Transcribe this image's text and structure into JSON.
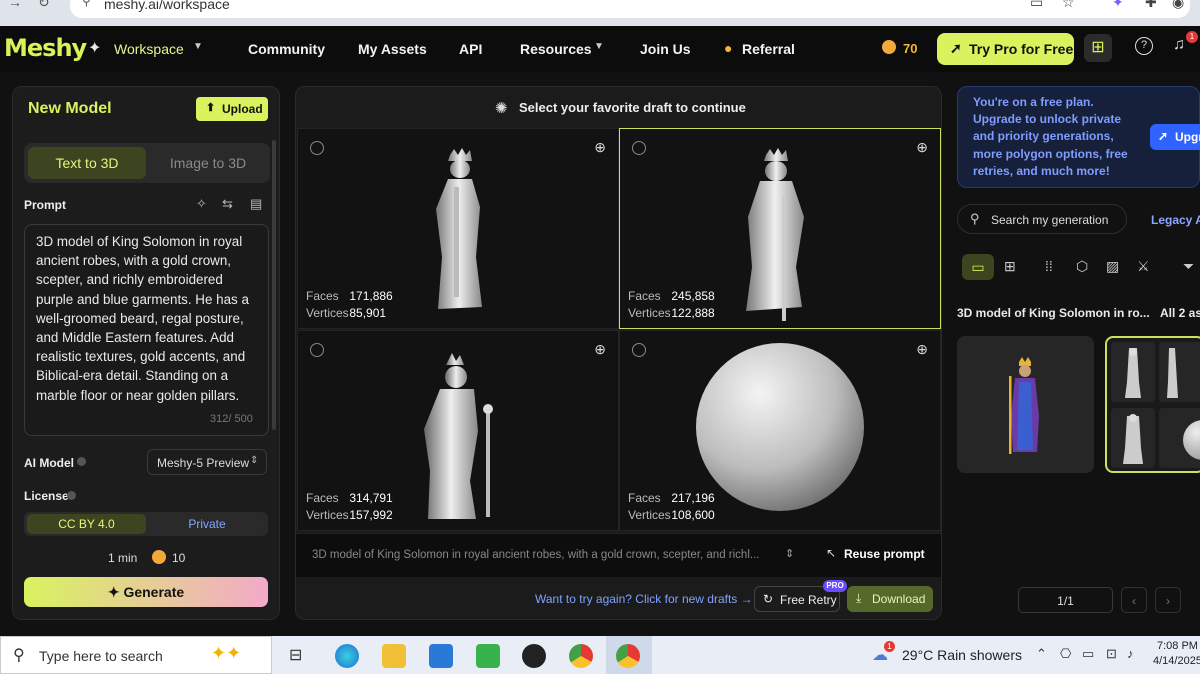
{
  "browser": {
    "url": "meshy.ai/workspace"
  },
  "nav": {
    "logo": "Meshy",
    "workspace": "Workspace",
    "community": "Community",
    "my_assets": "My Assets",
    "api": "API",
    "resources": "Resources",
    "join_us": "Join Us",
    "referral": "Referral",
    "credits": "70",
    "try_pro": "Try Pro for Free",
    "notification_count": "1"
  },
  "left": {
    "title": "New Model",
    "upload": "Upload",
    "tab_text": "Text to 3D",
    "tab_image": "Image to 3D",
    "prompt_label": "Prompt",
    "prompt_text": "3D model of King Solomon in royal ancient robes, with a gold crown, scepter, and richly embroidered purple and blue garments. He has a well-groomed beard, regal posture, and Middle Eastern features. Add realistic textures, gold accents, and Biblical-era detail. Standing on a marble floor or near golden pillars.",
    "char_count": "312/ 500",
    "ai_model_label": "AI Model",
    "ai_model_value": "Meshy-5 Preview",
    "license_label": "License",
    "license_a": "CC BY 4.0",
    "license_b": "Private",
    "time": "1 min",
    "cost": "10",
    "generate": "Generate"
  },
  "center": {
    "header": "Select your favorite draft to continue",
    "faces_label": "Faces",
    "vertices_label": "Vertices",
    "drafts": [
      {
        "faces": "171,886",
        "vertices": "85,901",
        "selected": false
      },
      {
        "faces": "245,858",
        "vertices": "122,888",
        "selected": true
      },
      {
        "faces": "314,791",
        "vertices": "157,992",
        "selected": false
      },
      {
        "faces": "217,196",
        "vertices": "108,600",
        "selected": false
      }
    ],
    "prompt_preview": "3D model of King Solomon in royal ancient robes, with a gold crown, scepter, and richl...",
    "reuse_prompt": "Reuse prompt",
    "retry_link": "Want to try again? Click for new drafts",
    "free_retry": "Free Retry",
    "pro_badge": "PRO",
    "download": "Download"
  },
  "right": {
    "free_plan": "You're on a free plan. Upgrade to unlock private and priority generations, more polygon options, free retries, and much more!",
    "upgrade": "Upgr",
    "search_placeholder": "Search my generation",
    "legacy": "Legacy As",
    "gen_title": "3D model of King Solomon in ro...",
    "all_assets": "All 2 ass",
    "page": "1/1"
  },
  "taskbar": {
    "search": "Type here to search",
    "weather_temp": "29°C",
    "weather_text": "Rain showers",
    "time": "7:08 PM",
    "date": "4/14/2025",
    "weather_badge": "1"
  },
  "colors": {
    "accent": "#d9f25e",
    "link": "#7fa2ff",
    "bg": "#111111"
  }
}
